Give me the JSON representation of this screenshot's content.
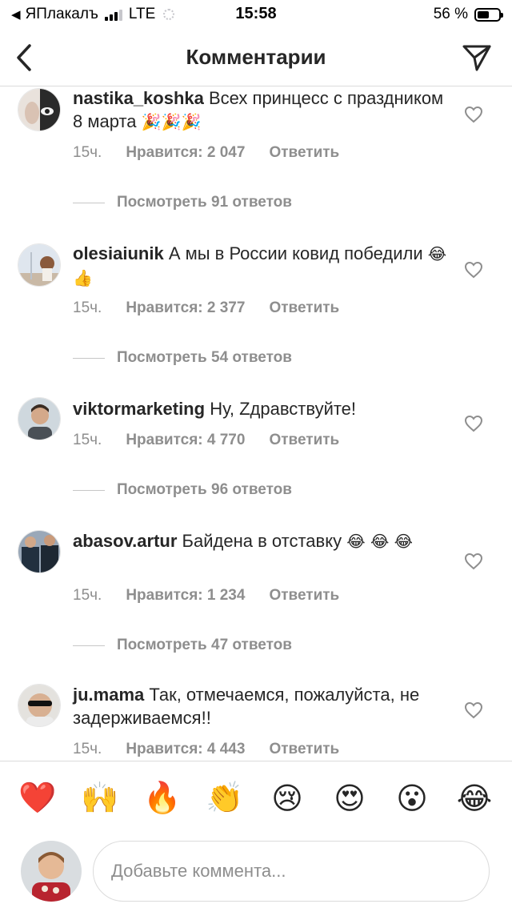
{
  "status_bar": {
    "back_app": "ЯПлакалъ",
    "network": "LTE",
    "time": "15:58",
    "battery": "56 %",
    "battery_level": 0.56
  },
  "nav": {
    "title": "Комментарии"
  },
  "comments": [
    {
      "username": "nastika_koshka",
      "text": "Всех принцесс с праздником 8 марта",
      "emojis": "🎉🎉🎉",
      "time": "15ч.",
      "likes": "Нравится: 2 047",
      "reply": "Ответить",
      "view_replies": "Посмотреть 91 ответов"
    },
    {
      "username": "olesiaiunik",
      "text": "А мы в России ковид победили",
      "emojis": "😂👍",
      "time": "15ч.",
      "likes": "Нравится: 2 377",
      "reply": "Ответить",
      "view_replies": "Посмотреть 54 ответов"
    },
    {
      "username": "viktormarketing",
      "text": "Ну, Zдравствуйте!",
      "emojis": "",
      "time": "15ч.",
      "likes": "Нравится: 4 770",
      "reply": "Ответить",
      "view_replies": "Посмотреть 96 ответов"
    },
    {
      "username": "abasov.artur",
      "text": "Байдена в отставку",
      "emojis": "😂 😂 😂",
      "time": "15ч.",
      "likes": "Нравится: 1 234",
      "reply": "Ответить",
      "view_replies": "Посмотреть 47 ответов"
    },
    {
      "username": "ju.mama",
      "text": "Так, отмечаемся, пожалуйста, не задерживаемся!!",
      "emojis": "",
      "time": "15ч.",
      "likes": "Нравится: 4 443",
      "reply": "Ответить",
      "view_replies": ""
    }
  ],
  "emoji_bar": [
    "❤️",
    "🙌",
    "🔥",
    "👏",
    "😢",
    "😍",
    "😮",
    "😂"
  ],
  "input": {
    "placeholder": "Добавьте коммента..."
  },
  "colors": {
    "text": "#262626",
    "secondary": "#8e8e8e",
    "divider": "#dbdbdb"
  }
}
